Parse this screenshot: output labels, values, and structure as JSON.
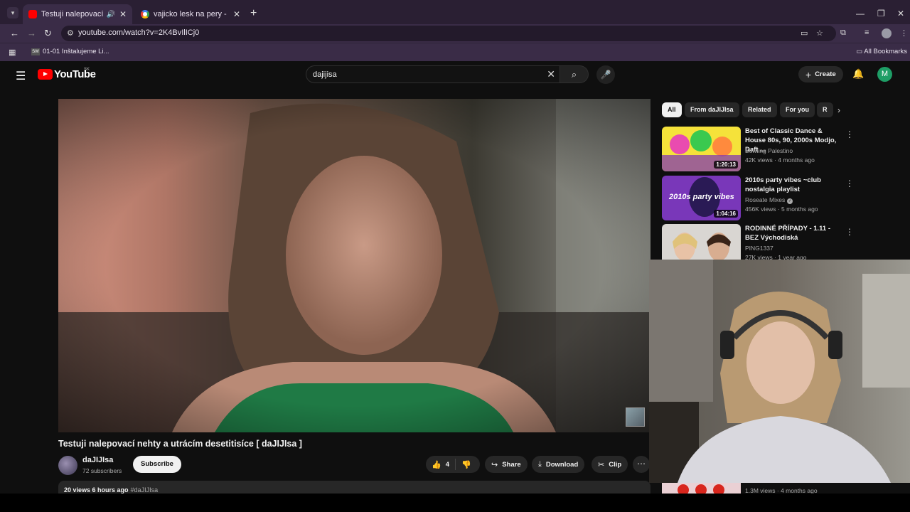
{
  "browser": {
    "tabs": [
      {
        "title": "Testuji nalepovací nehty a u",
        "active": true
      },
      {
        "title": "vajicko lesk na pery - Google S",
        "active": false
      }
    ],
    "url": "youtube.com/watch?v=2K4BvIlICj0",
    "bookmark": "01-01 Inštalujeme Li...",
    "bookmark_icon": "SW",
    "all_bookmarks": "All Bookmarks"
  },
  "youtube": {
    "logo_text": "YouTube",
    "region": "SK",
    "search_value": "dajijisa",
    "create_label": "Create",
    "avatar_letter": "M"
  },
  "video": {
    "title": "Testuji nalepovací nehty a utrácím desetitisíce [ daJIJIsa ]",
    "channel": "daJIJIsa",
    "subscribers": "72 subscribers",
    "subscribe_label": "Subscribe",
    "likes": "4",
    "share_label": "Share",
    "download_label": "Download",
    "clip_label": "Clip",
    "views_time": "20 views  6 hours ago",
    "hashtag": "#daJIJIsa"
  },
  "chips": [
    "All",
    "From daJIJIsa",
    "Related",
    "For you",
    "R"
  ],
  "recommendations": [
    {
      "title": "Best of Classic Dance & House 80s, 90, 2000s Modjo, Daft ...",
      "channel": "Bowling Palestino",
      "meta": "42K views · 4 months ago",
      "duration": "1:20:13",
      "verified": false
    },
    {
      "title": "2010s party vibes ~club nostalgia playlist",
      "channel": "Roseate Mixes",
      "meta": "456K views · 5 months ago",
      "duration": "1:04:16",
      "verified": true,
      "thumb_text": "2010s party vibes"
    },
    {
      "title": "RODINNÉ PŘÍPADY - 1.11 - BEZ Východiská",
      "channel": "PING1337",
      "meta": "27K views · 1 year ago",
      "duration": "",
      "verified": false
    }
  ],
  "rec_bottom_meta": "1.3M views · 4 months ago",
  "colors": {
    "accent": "#ff0000",
    "avatar": "#1e9e66",
    "background": "#0f0f0f"
  }
}
